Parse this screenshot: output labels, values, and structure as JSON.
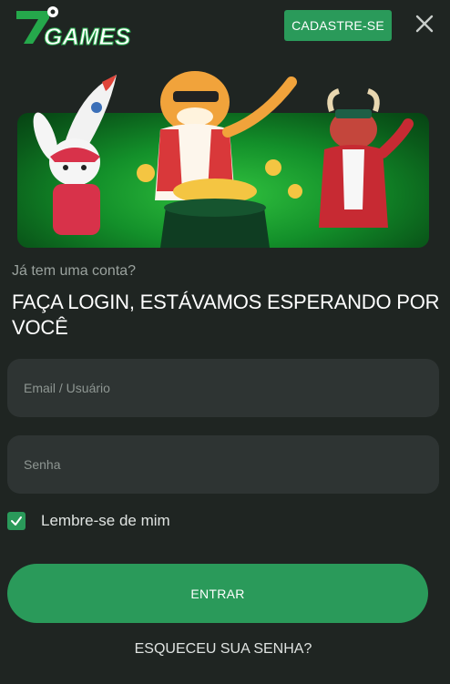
{
  "header": {
    "logo_text": "7GAMES",
    "signup_label": "CADASTRE-SE",
    "close_icon": "close-icon"
  },
  "banner": {
    "icons": [
      "rabbit-character",
      "tiger-character",
      "bull-character",
      "rocket",
      "gold-coin-pot"
    ]
  },
  "login": {
    "subtitle": "Já tem uma conta?",
    "title": "FAÇA LOGIN, ESTÁVAMOS ESPERANDO POR VOCÊ",
    "email_placeholder": "Email / Usuário",
    "password_placeholder": "Senha",
    "remember_label": "Lembre-se de mim",
    "remember_checked": true,
    "submit_label": "ENTRAR",
    "forgot_label": "ESQUECEU SUA SENHA?"
  },
  "colors": {
    "background": "#1f2522",
    "accent": "#2a9a5a",
    "field": "#2e3433",
    "muted_text": "#9aa29e"
  }
}
